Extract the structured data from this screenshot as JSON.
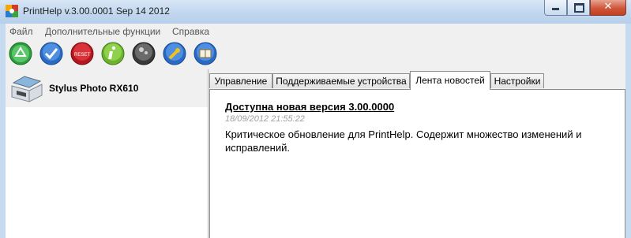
{
  "window": {
    "title": "PrintHelp v.3.00.0001 Sep 14 2012",
    "close_glyph": "✕"
  },
  "menu": [
    "Файл",
    "Дополнительные функции",
    "Справка"
  ],
  "toolbar": {
    "icons": [
      "recycle-icon",
      "check-icon",
      "reset-icon",
      "info-icon",
      "disc-icon",
      "wrench-icon",
      "book-icon"
    ],
    "reset_label": "RESET"
  },
  "device": {
    "name": "Stylus Photo RX610"
  },
  "tabs": [
    "Управление",
    "Поддерживаемые устройства",
    "Лента новостей",
    "Настройки"
  ],
  "active_tab": "Лента новостей",
  "news": {
    "title": "Доступна новая версия 3.00.0000",
    "date": "18/09/2012 21:55:22",
    "body": "Критическое обновление для PrintHelp. Содержит множество изменений и исправлений."
  },
  "colors": {
    "close_button": "#c43f21",
    "titlebar": "#c3d8ef",
    "date_text": "#a0a0a0"
  }
}
